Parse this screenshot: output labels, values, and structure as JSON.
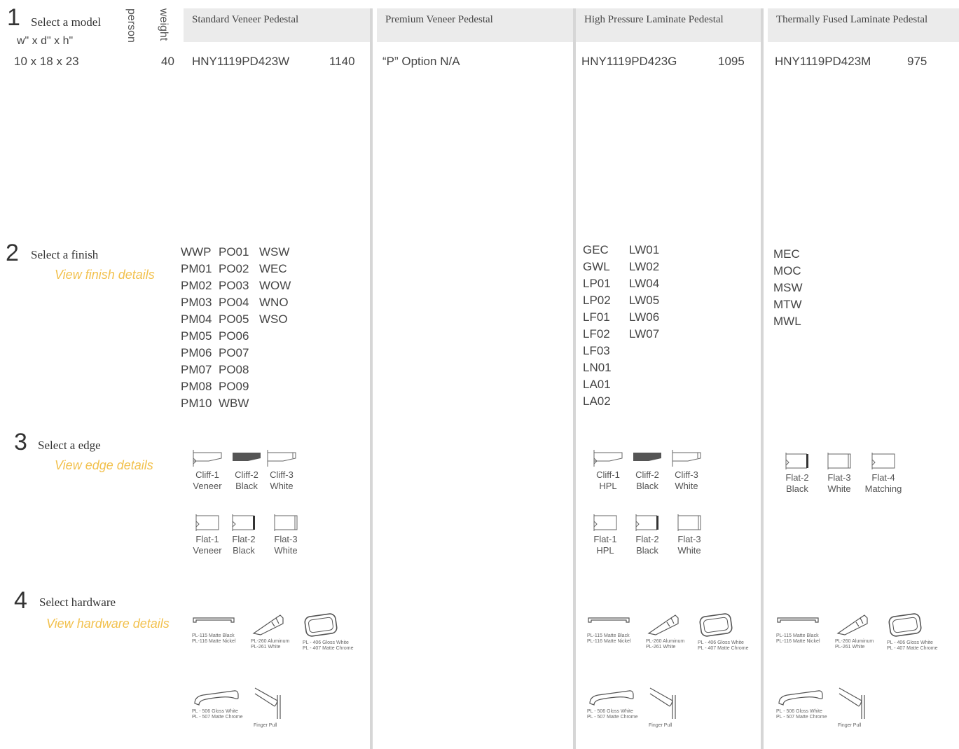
{
  "steps": {
    "s1": {
      "num": "1",
      "title": "Select a model",
      "dims": "w\" x  d\" x  h\"",
      "person_label": "person",
      "weight_label": "weight"
    },
    "s2": {
      "num": "2",
      "title": "Select a finish",
      "link": "View finish details"
    },
    "s3": {
      "num": "3",
      "title": "Select a edge",
      "link": "View edge details"
    },
    "s4": {
      "num": "4",
      "title": "Select hardware",
      "link": "View hardware details"
    }
  },
  "model_row": {
    "size": "10 x 18 x 23",
    "weight": "40"
  },
  "columns": [
    {
      "header": "Standard Veneer Pedestal",
      "part": "HNY1119PD423W",
      "price": "1140",
      "finishes": [
        "WWP",
        "PO01",
        "WSW",
        "PM01",
        "PO02",
        "WEC",
        "PM02",
        "PO03",
        "WOW",
        "PM03",
        "PO04",
        "WNO",
        "PM04",
        "PO05",
        "WSO",
        "PM05",
        "PO06",
        "",
        "PM06",
        "PO07",
        "",
        "PM07",
        "PO08",
        "",
        "PM08",
        "PO09",
        "",
        "PM10",
        "WBW",
        ""
      ],
      "edges_top": [
        {
          "name": "Cliff-1",
          "sub": "Veneer"
        },
        {
          "name": "Cliff-2",
          "sub": "Black"
        },
        {
          "name": "Cliff-3",
          "sub": "White"
        }
      ],
      "edges_bottom": [
        {
          "name": "Flat-1",
          "sub": "Veneer"
        },
        {
          "name": "Flat-2",
          "sub": "Black"
        },
        {
          "name": "Flat-3",
          "sub": "White"
        }
      ]
    },
    {
      "header": "Premium Veneer Pedestal",
      "part": "“P” Option N/A"
    },
    {
      "header": "High Pressure Laminate Pedestal",
      "part": "HNY1119PD423G",
      "price": "1095",
      "finishes": [
        "GEC",
        "LW01",
        "GWL",
        "LW02",
        "LP01",
        "LW04",
        "LP02",
        "LW05",
        "LF01",
        "LW06",
        "LF02",
        "LW07",
        "LF03",
        "",
        "LN01",
        "",
        "LA01",
        "",
        "LA02",
        ""
      ],
      "edges_top": [
        {
          "name": "Cliff-1",
          "sub": "HPL"
        },
        {
          "name": "Cliff-2",
          "sub": "Black"
        },
        {
          "name": "Cliff-3",
          "sub": "White"
        }
      ],
      "edges_bottom": [
        {
          "name": "Flat-1",
          "sub": "HPL"
        },
        {
          "name": "Flat-2",
          "sub": "Black"
        },
        {
          "name": "Flat-3",
          "sub": "White"
        }
      ]
    },
    {
      "header": "Thermally Fused Laminate Pedestal",
      "part": "HNY1119PD423M",
      "price": "975",
      "finishes": [
        "MEC",
        "MOC",
        "MSW",
        "MTW",
        "MWL"
      ],
      "edges_top": [
        {
          "name": "Flat-2",
          "sub": "Black"
        },
        {
          "name": "Flat-3",
          "sub": "White"
        },
        {
          "name": "Flat-4",
          "sub": "Matching"
        }
      ]
    }
  ],
  "hardware": {
    "h1": "PL-115 Matte Black",
    "h1b": "PL-116 Matte Nickel",
    "h2": "PL-260 Aluminum",
    "h2b": "PL-261 White",
    "h3": "PL - 406 Gloss White",
    "h3b": "PL - 407 Matte Chrome",
    "h4": "PL - 506 Gloss White",
    "h4b": "PL - 507 Matte Chrome",
    "h5": "Finger Pull"
  },
  "colors": {
    "link_gold": "#f2c14e",
    "header_bg": "#ebebeb",
    "divider": "#d6d6d6",
    "edge_black": "#555555"
  }
}
